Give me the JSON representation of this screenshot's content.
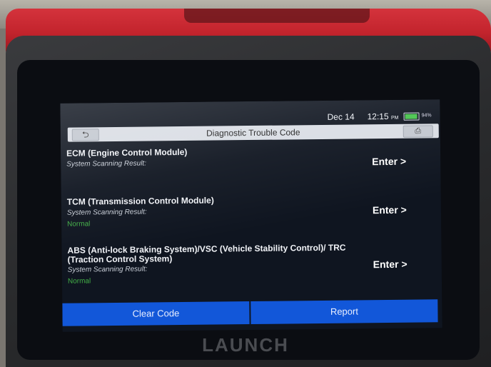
{
  "status_bar": {
    "date": "Dec 14",
    "time": "12:15",
    "ampm": "PM",
    "battery_level": "94%",
    "battery_fraction": 0.94
  },
  "header": {
    "title": "Diagnostic Trouble Code",
    "back_icon": "back-arrow-icon",
    "exit_icon": "exit-door-icon"
  },
  "systems": [
    {
      "name": "ECM (Engine Control Module)",
      "scan_label": "System Scanning Result:",
      "status": "",
      "enter_label": "Enter >"
    },
    {
      "name": "TCM (Transmission Control Module)",
      "scan_label": "System Scanning Result:",
      "status": "Normal",
      "enter_label": "Enter >"
    },
    {
      "name": "ABS (Anti-lock Braking System)/VSC (Vehicle Stability Control)/ TRC (Traction Control System)",
      "scan_label": "System Scanning Result:",
      "status": "Normal",
      "enter_label": "Enter >"
    }
  ],
  "actions": {
    "clear_code": "Clear Code",
    "report": "Report"
  },
  "device": {
    "brand": "LAUNCH",
    "bumper_color": "#c3242d",
    "accent_color": "#1257d9",
    "status_ok_color": "#43b047"
  }
}
